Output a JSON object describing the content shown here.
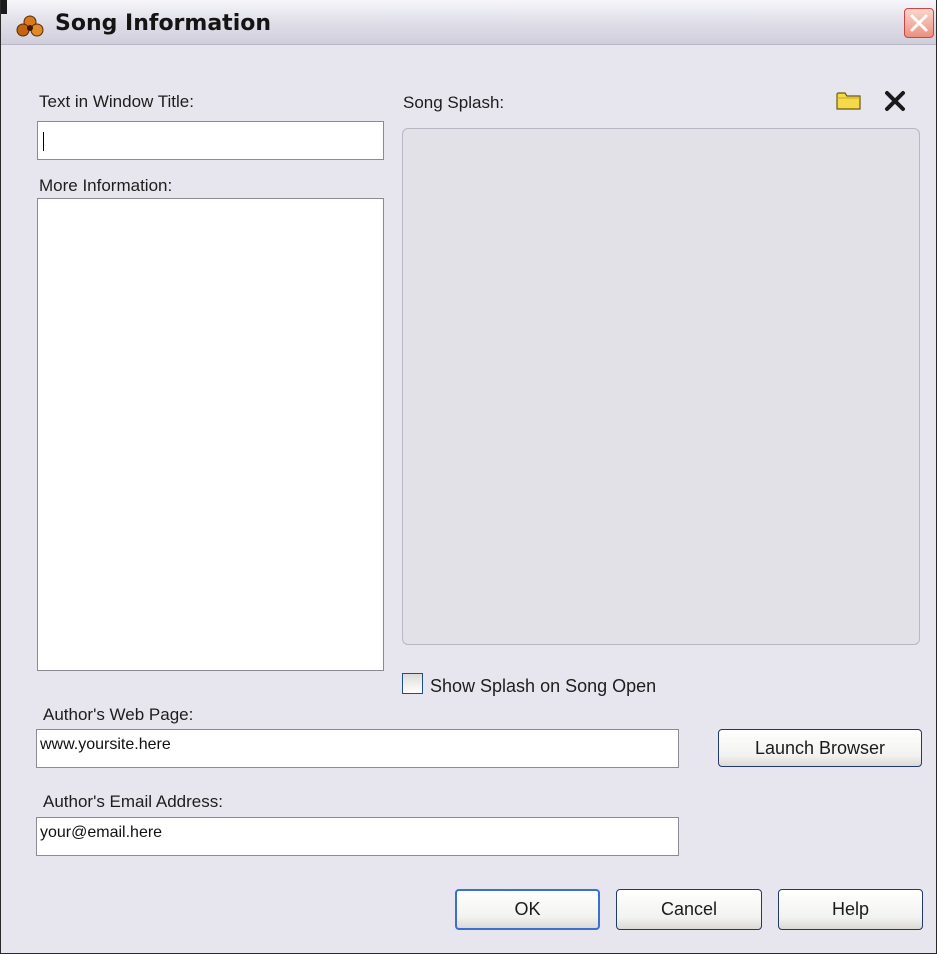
{
  "window": {
    "title": "Song Information",
    "app_icon": "app-logo-icon",
    "close_icon": "close-icon"
  },
  "fields": {
    "window_title_label": "Text in Window Title:",
    "window_title_value": "",
    "more_info_label": "More Information:",
    "more_info_value": "",
    "web_page_label": "Author's Web Page:",
    "web_page_value": "www.yoursite.here",
    "email_label": "Author's Email Address:",
    "email_value": "your@email.here"
  },
  "splash": {
    "label": "Song Splash:",
    "open_icon": "folder-icon",
    "clear_icon": "clear-icon",
    "show_on_open_label": "Show Splash on Song Open",
    "show_on_open_checked": false
  },
  "buttons": {
    "launch_browser": "Launch Browser",
    "ok": "OK",
    "cancel": "Cancel",
    "help": "Help"
  },
  "colors": {
    "dialog_background": "#e7e6ee",
    "default_button_border": "#3c6fd1",
    "close_button": "#ec8f7e"
  }
}
